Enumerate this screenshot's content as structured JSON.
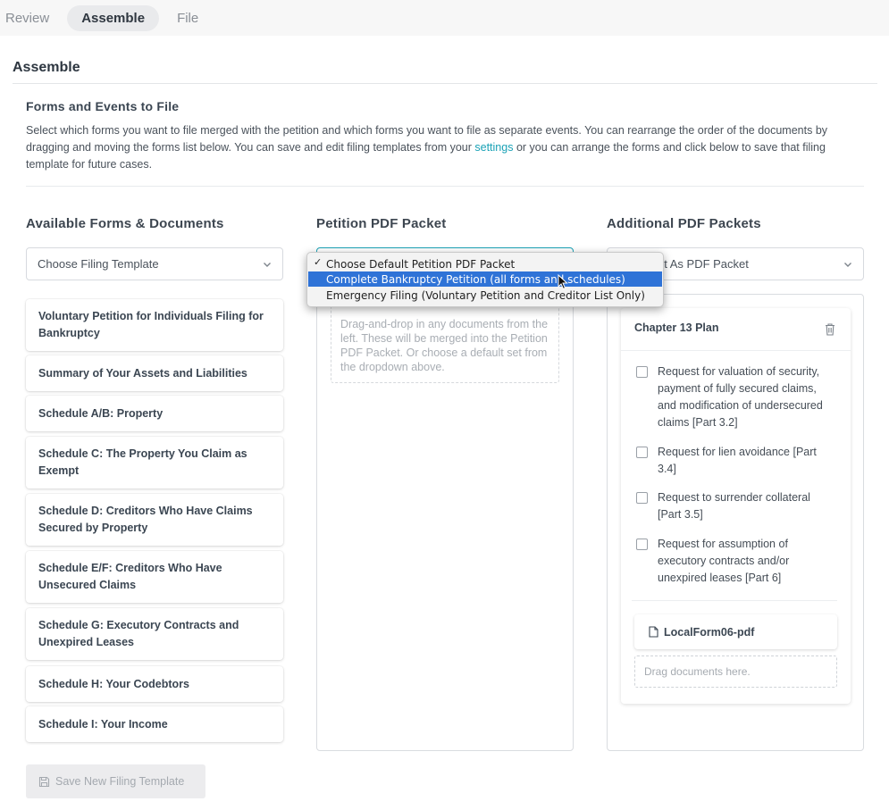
{
  "tabs": [
    {
      "label": "Review"
    },
    {
      "label": "Assemble"
    },
    {
      "label": "File"
    }
  ],
  "page_title": "Assemble",
  "section": {
    "title": "Forms and Events to File",
    "desc_1": "Select which forms you want to file merged with the petition and which forms you want to file as separate events. You can rearrange the order of the documents by dragging and moving the forms list below. You can save and edit filing templates from your ",
    "desc_link": "settings",
    "desc_2": " or you can arrange the forms and click below to save that filing template for future cases."
  },
  "available": {
    "title": "Available Forms & Documents",
    "select_value": "Choose Filing Template",
    "forms": [
      "Voluntary Petition for Individuals Filing for Bankruptcy",
      "Summary of Your Assets and Liabilities",
      "Schedule A/B: Property",
      "Schedule C: The Property You Claim as Exempt",
      "Schedule D: Creditors Who Have Claims Secured by Property",
      "Schedule E/F: Creditors Who Have Unsecured Claims",
      "Schedule G: Executory Contracts and Unexpired Leases",
      "Schedule H: Your Codebtors",
      "Schedule I: Your Income"
    ],
    "save_button": "Save New Filing Template"
  },
  "petition": {
    "title": "Petition PDF Packet",
    "dropzone_text": "Drag-and-drop in any documents from the left. These will be merged into the Petition PDF Packet. Or choose a default set from the dropdown above.",
    "dropdown_options": [
      "Choose Default Petition PDF Packet",
      "Complete Bankruptcy Petition (all forms and schedules)",
      "Emergency Filing (Voluntary Petition and Creditor List Only)"
    ],
    "checked_mark": "✓"
  },
  "additional": {
    "title": "Additional PDF Packets",
    "select_value": "nt As PDF Packet",
    "plan": {
      "title": "Chapter 13 Plan",
      "items": [
        "Request for valuation of security, payment of fully secured claims, and modification of undersecured claims [Part 3.2]",
        "Request for lien avoidance [Part 3.4]",
        "Request to surrender collateral [Part 3.5]",
        "Request for assumption of executory contracts and/or unexpired leases [Part 6]"
      ],
      "file": "LocalForm06-pdf",
      "drag_placeholder": "Drag documents here."
    }
  },
  "colors": {
    "accent_link": "#1aa2b6",
    "dropdown_highlight": "#2f73d7"
  }
}
